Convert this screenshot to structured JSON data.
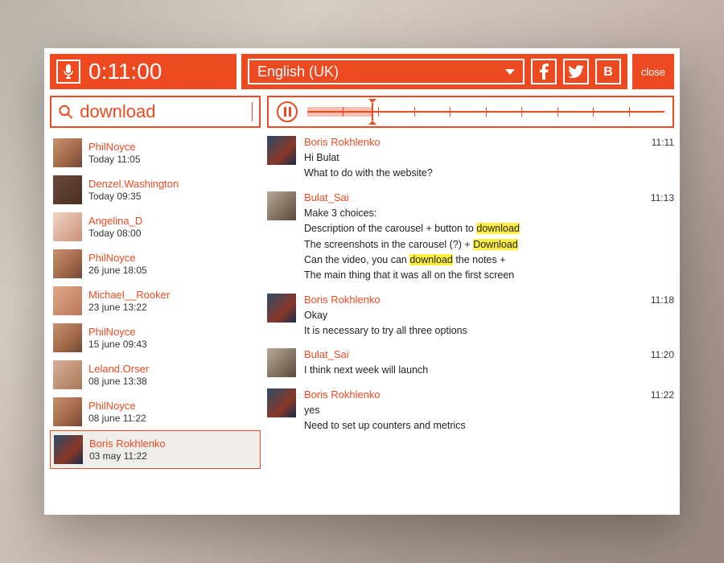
{
  "colors": {
    "accent": "#ee4a22",
    "highlight": "#ffee3b"
  },
  "header": {
    "timer": "0:11:00",
    "language_selected": "English (UK)",
    "close_label": "close",
    "social": [
      "facebook",
      "twitter",
      "vkontakte"
    ]
  },
  "search": {
    "value": "download"
  },
  "player": {
    "progress_pct": 18,
    "segments": 10
  },
  "contacts": [
    {
      "name": "PhilNoyce",
      "time": "Today 11:05",
      "avatar": "phil",
      "selected": false
    },
    {
      "name": "Denzel.Washington",
      "time": "Today 09:35",
      "avatar": "denzel",
      "selected": false
    },
    {
      "name": "Angelina_D",
      "time": "Today 08:00",
      "avatar": "angelina",
      "selected": false
    },
    {
      "name": "PhilNoyce",
      "time": "26 june 18:05",
      "avatar": "phil",
      "selected": false
    },
    {
      "name": "Michael__Rooker",
      "time": "23 june 13:22",
      "avatar": "michael",
      "selected": false
    },
    {
      "name": "PhilNoyce",
      "time": "15 june 09:43",
      "avatar": "phil",
      "selected": false
    },
    {
      "name": "Leland.Orser",
      "time": "08 june 13:38",
      "avatar": "leland",
      "selected": false
    },
    {
      "name": "PhilNoyce",
      "time": "08 june 11:22",
      "avatar": "phil",
      "selected": false
    },
    {
      "name": "Boris Rokhlenko",
      "time": "03 may 11:22",
      "avatar": "boris",
      "selected": true
    }
  ],
  "messages": [
    {
      "author": "Boris Rokhlenko",
      "avatar": "boris",
      "time": "11:11",
      "lines": [
        "Hi Bulat",
        "What to do with the website?"
      ]
    },
    {
      "author": "Bulat_Sai",
      "avatar": "bulat",
      "time": "11:13",
      "lines": [
        "Make 3 choices:",
        "Description of the carousel + button to {hl}download{/hl}",
        "The screenshots in the carousel (?) + {hl}Download{/hl}",
        "Can the video, you can {hl}download{/hl} the notes +",
        "The main thing that it was all on the first screen"
      ]
    },
    {
      "author": "Boris Rokhlenko",
      "avatar": "boris",
      "time": "11:18",
      "lines": [
        "Okay",
        "It is necessary to try all three options"
      ]
    },
    {
      "author": "Bulat_Sai",
      "avatar": "bulat",
      "time": "11:20",
      "lines": [
        "I think next week will launch"
      ]
    },
    {
      "author": "Boris Rokhlenko",
      "avatar": "boris",
      "time": "11:22",
      "lines": [
        "yes",
        "Need to set up counters and metrics"
      ]
    }
  ]
}
